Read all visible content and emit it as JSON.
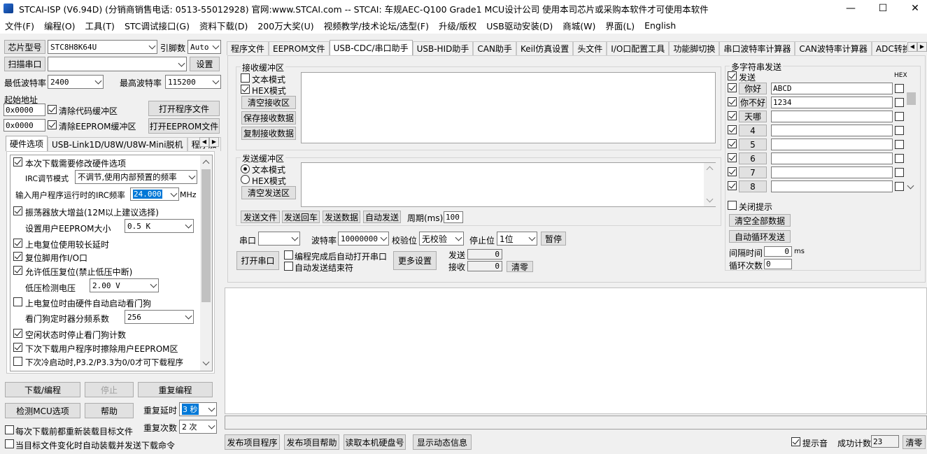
{
  "window": {
    "title": "STCAI-ISP (V6.94D) (分销商销售电话: 0513-55012928) 官网:www.STCAI.com  -- STCAI: 车规AEC-Q100 Grade1 MCU设计公司 使用本司芯片或采购本软件才可使用本软件"
  },
  "menu": [
    "文件(F)",
    "编程(O)",
    "工具(T)",
    "STC调试接口(G)",
    "资料下载(D)",
    "200万大奖(U)",
    "视频教学/技术论坛/选型(F)",
    "升级/版权",
    "USB驱动安装(D)",
    "商城(W)",
    "界面(L)",
    "English"
  ],
  "left": {
    "chip_label": "芯片型号",
    "chip_value": "STC8H8K64U",
    "pins_label": "引脚数",
    "pins_value": "Auto",
    "scan_label": "扫描串口",
    "port_value": "",
    "settings_label": "设置",
    "min_baud_label": "最低波特率",
    "min_baud": "2400",
    "max_baud_label": "最高波特率",
    "max_baud": "115200",
    "start_addr_label": "起始地址",
    "addr1": "0x0000",
    "clear_code_label": "清除代码缓冲区",
    "open_program_label": "打开程序文件",
    "addr2": "0x0000",
    "clear_eeprom_label": "清除EEPROM缓冲区",
    "open_eeprom_label": "打开EEPROM文件",
    "tabs": [
      "硬件选项",
      "USB-Link1D/U8W/U8W-Mini脱机",
      "程序加"
    ],
    "options": {
      "opt1": "本次下载需要修改硬件选项",
      "irc_mode_label": "IRC调节模式",
      "irc_mode_value": "不调节,使用内部预置的频率",
      "irc_freq_label": "输入用户程序运行时的IRC频率",
      "irc_freq_value": "24.000",
      "irc_unit": "MHz",
      "opt2": "振荡器放大增益(12M以上建议选择)",
      "eeprom_size_label": "设置用户EEPROM大小",
      "eeprom_size_value": "0.5 K",
      "opt3": "上电复位使用较长延时",
      "opt4": "复位脚用作I/O口",
      "opt5": "允许低压复位(禁止低压中断)",
      "lvd_label": "低压检测电压",
      "lvd_value": "2.00 V",
      "opt6": "上电复位时由硬件自动启动看门狗",
      "wdt_label": "看门狗定时器分频系数",
      "wdt_value": "256",
      "opt7": "空闲状态时停止看门狗计数",
      "opt8": "下次下载用户程序时擦除用户EEPROM区",
      "opt9": "下次冷启动时,P3.2/P3.3为0/0才可下载程序"
    },
    "download_label": "下载/编程",
    "stop_label": "停止",
    "reprogram_label": "重复编程",
    "check_mcu_label": "检测MCU选项",
    "help_label": "帮助",
    "repeat_delay_label": "重复延时",
    "repeat_delay_value": "3 秒",
    "repeat_count_label": "重复次数",
    "repeat_count_value": "2 次",
    "reload_label": "每次下载前都重新装载目标文件",
    "auto_send_label": "当目标文件变化时自动装载并发送下载命令"
  },
  "right_tabs": [
    "程序文件",
    "EEPROM文件",
    "USB-CDC/串口助手",
    "USB-HID助手",
    "CAN助手",
    "Keil仿真设置",
    "头文件",
    "I/O口配置工具",
    "功能脚切换",
    "串口波特率计算器",
    "CAN波特率计算器",
    "ADC转换速度计算"
  ],
  "serial": {
    "recv_title": "接收缓冲区",
    "recv_text_mode": "文本模式",
    "recv_hex_mode": "HEX模式",
    "clear_recv": "清空接收区",
    "save_recv": "保存接收数据",
    "copy_recv": "复制接收数据",
    "send_title": "发送缓冲区",
    "send_text_mode": "文本模式",
    "send_hex_mode": "HEX模式",
    "clear_send": "清空发送区",
    "send_file": "发送文件",
    "send_enter": "发送回车",
    "send_data": "发送数据",
    "auto_send": "自动发送",
    "period_label": "周期(ms)",
    "period_value": "100",
    "port_label": "串口",
    "port_value": "",
    "baud_label": "波特率",
    "baud_value": "10000000",
    "parity_label": "校验位",
    "parity_value": "无校验",
    "stopbit_label": "停止位",
    "stopbit_value": "1位",
    "pause_label": "暂停",
    "open_port": "打开串口",
    "open_after_prog": "编程完成后自动打开串口",
    "auto_send_end": "自动发送结束符",
    "more_settings": "更多设置",
    "send_count_label": "发送",
    "send_count": "0",
    "recv_count_label": "接收",
    "recv_count": "0",
    "clear_count": "清零"
  },
  "multi": {
    "title": "多字符串发送",
    "send_col": "发送",
    "hex_col": "HEX",
    "rows": [
      {
        "name": "你好",
        "value": "ABCD"
      },
      {
        "name": "你不好",
        "value": "1234"
      },
      {
        "name": "天哪",
        "value": ""
      },
      {
        "name": "4",
        "value": ""
      },
      {
        "name": "5",
        "value": ""
      },
      {
        "name": "6",
        "value": ""
      },
      {
        "name": "7",
        "value": ""
      },
      {
        "name": "8",
        "value": ""
      }
    ],
    "close_hint": "关闭提示",
    "clear_all": "清空全部数据",
    "auto_loop": "自动循环发送",
    "interval_label": "间隔时间",
    "interval_value": "0",
    "interval_unit": "ms",
    "loop_label": "循环次数",
    "loop_value": "0"
  },
  "bottom": {
    "publish_program": "发布项目程序",
    "publish_help": "发布项目帮助",
    "read_disk": "读取本机硬盘号",
    "show_dynamic": "显示动态信息",
    "sound_label": "提示音",
    "success_label": "成功计数",
    "success_value": "23",
    "clear_label": "清零"
  }
}
